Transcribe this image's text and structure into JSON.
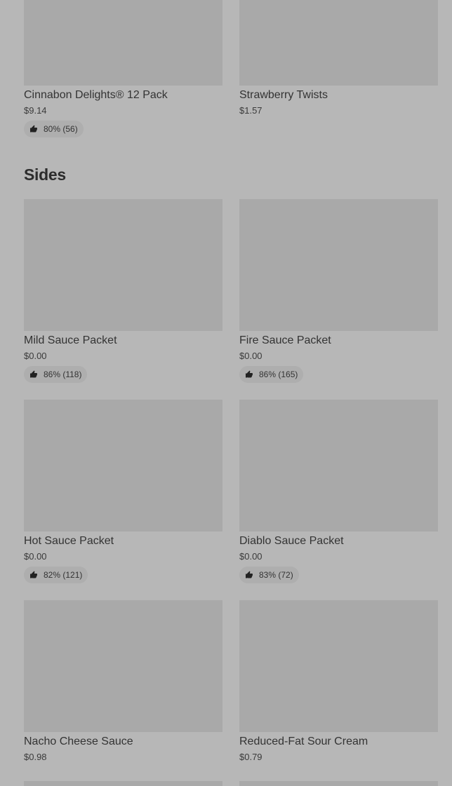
{
  "top_items": [
    {
      "name": "Cinnabon Delights® 12 Pack",
      "price": "$9.14",
      "rating": "80% (56)"
    },
    {
      "name": "Strawberry Twists",
      "price": "$1.57",
      "rating": ""
    }
  ],
  "sides": {
    "title": "Sides",
    "items": [
      {
        "name": "Mild Sauce Packet",
        "price": "$0.00",
        "rating": "86% (118)"
      },
      {
        "name": "Fire Sauce Packet",
        "price": "$0.00",
        "rating": "86% (165)"
      },
      {
        "name": "Hot Sauce Packet",
        "price": "$0.00",
        "rating": "82% (121)"
      },
      {
        "name": "Diablo Sauce Packet",
        "price": "$0.00",
        "rating": "83% (72)"
      },
      {
        "name": "Nacho Cheese Sauce",
        "price": "$0.98",
        "rating": ""
      },
      {
        "name": "Reduced-Fat Sour Cream",
        "price": "$0.79",
        "rating": ""
      }
    ]
  },
  "icons": {
    "rating": "thumbs-up-icon"
  },
  "colors": {
    "background": "#b7b7b7",
    "image_placeholder": "#a9a9a9",
    "badge": "#aeaeae"
  }
}
